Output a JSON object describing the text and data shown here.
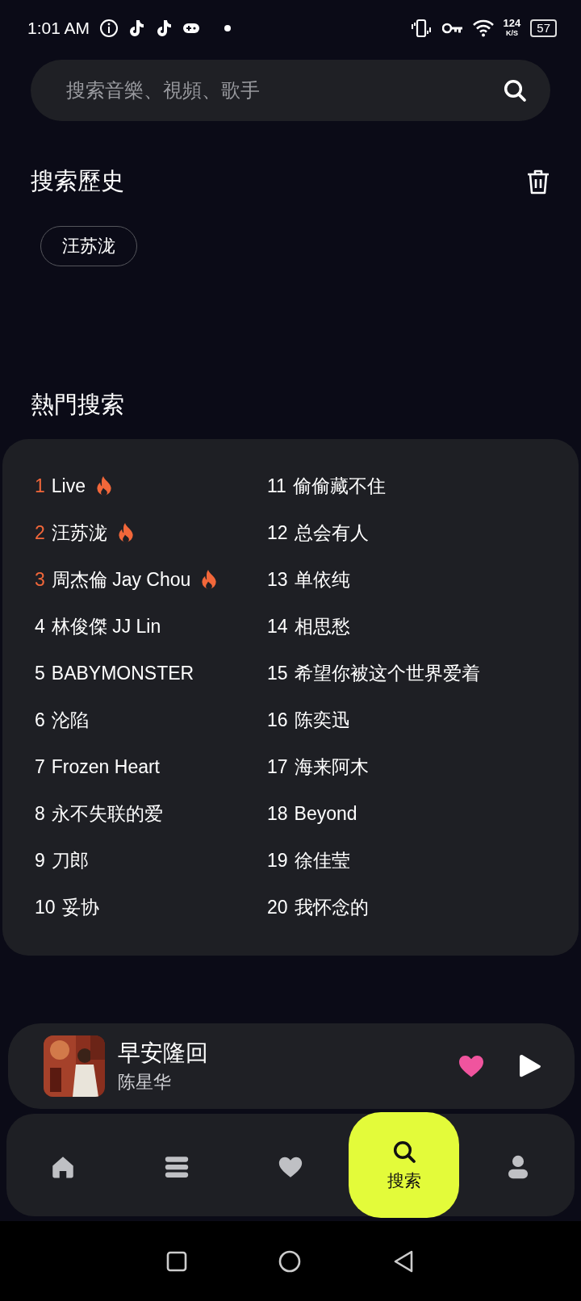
{
  "status_bar": {
    "time": "1:01 AM",
    "net_speed": "124",
    "net_unit": "K/S",
    "battery": "57"
  },
  "search": {
    "placeholder": "搜索音樂、視頻、歌手"
  },
  "history": {
    "title": "搜索歷史",
    "chips": [
      "汪苏泷"
    ]
  },
  "hot_search": {
    "title": "熱門搜索",
    "items": [
      {
        "rank": "1",
        "label": "Live",
        "hot": true
      },
      {
        "rank": "2",
        "label": "汪苏泷",
        "hot": true
      },
      {
        "rank": "3",
        "label": "周杰倫 Jay Chou",
        "hot": true
      },
      {
        "rank": "4",
        "label": "林俊傑 JJ Lin",
        "hot": false
      },
      {
        "rank": "5",
        "label": "BABYMONSTER",
        "hot": false
      },
      {
        "rank": "6",
        "label": "沦陷",
        "hot": false
      },
      {
        "rank": "7",
        "label": "Frozen Heart",
        "hot": false
      },
      {
        "rank": "8",
        "label": "永不失联的爱",
        "hot": false
      },
      {
        "rank": "9",
        "label": "刀郎",
        "hot": false
      },
      {
        "rank": "10",
        "label": "妥协",
        "hot": false
      },
      {
        "rank": "11",
        "label": "偷偷藏不住",
        "hot": false
      },
      {
        "rank": "12",
        "label": "总会有人",
        "hot": false
      },
      {
        "rank": "13",
        "label": "单依纯",
        "hot": false
      },
      {
        "rank": "14",
        "label": "相思愁",
        "hot": false
      },
      {
        "rank": "15",
        "label": "希望你被这个世界爱着",
        "hot": false
      },
      {
        "rank": "16",
        "label": "陈奕迅",
        "hot": false
      },
      {
        "rank": "17",
        "label": "海来阿木",
        "hot": false
      },
      {
        "rank": "18",
        "label": "Beyond",
        "hot": false
      },
      {
        "rank": "19",
        "label": "徐佳莹",
        "hot": false
      },
      {
        "rank": "20",
        "label": "我怀念的",
        "hot": false
      }
    ]
  },
  "now_playing": {
    "title": "早安隆回",
    "artist": "陈星华",
    "liked": true
  },
  "bottom_nav": [
    {
      "kind": "home",
      "selected": false
    },
    {
      "kind": "list",
      "selected": false
    },
    {
      "kind": "heart",
      "selected": false
    },
    {
      "kind": "search",
      "label": "搜索",
      "selected": true
    },
    {
      "kind": "person",
      "selected": false
    }
  ]
}
